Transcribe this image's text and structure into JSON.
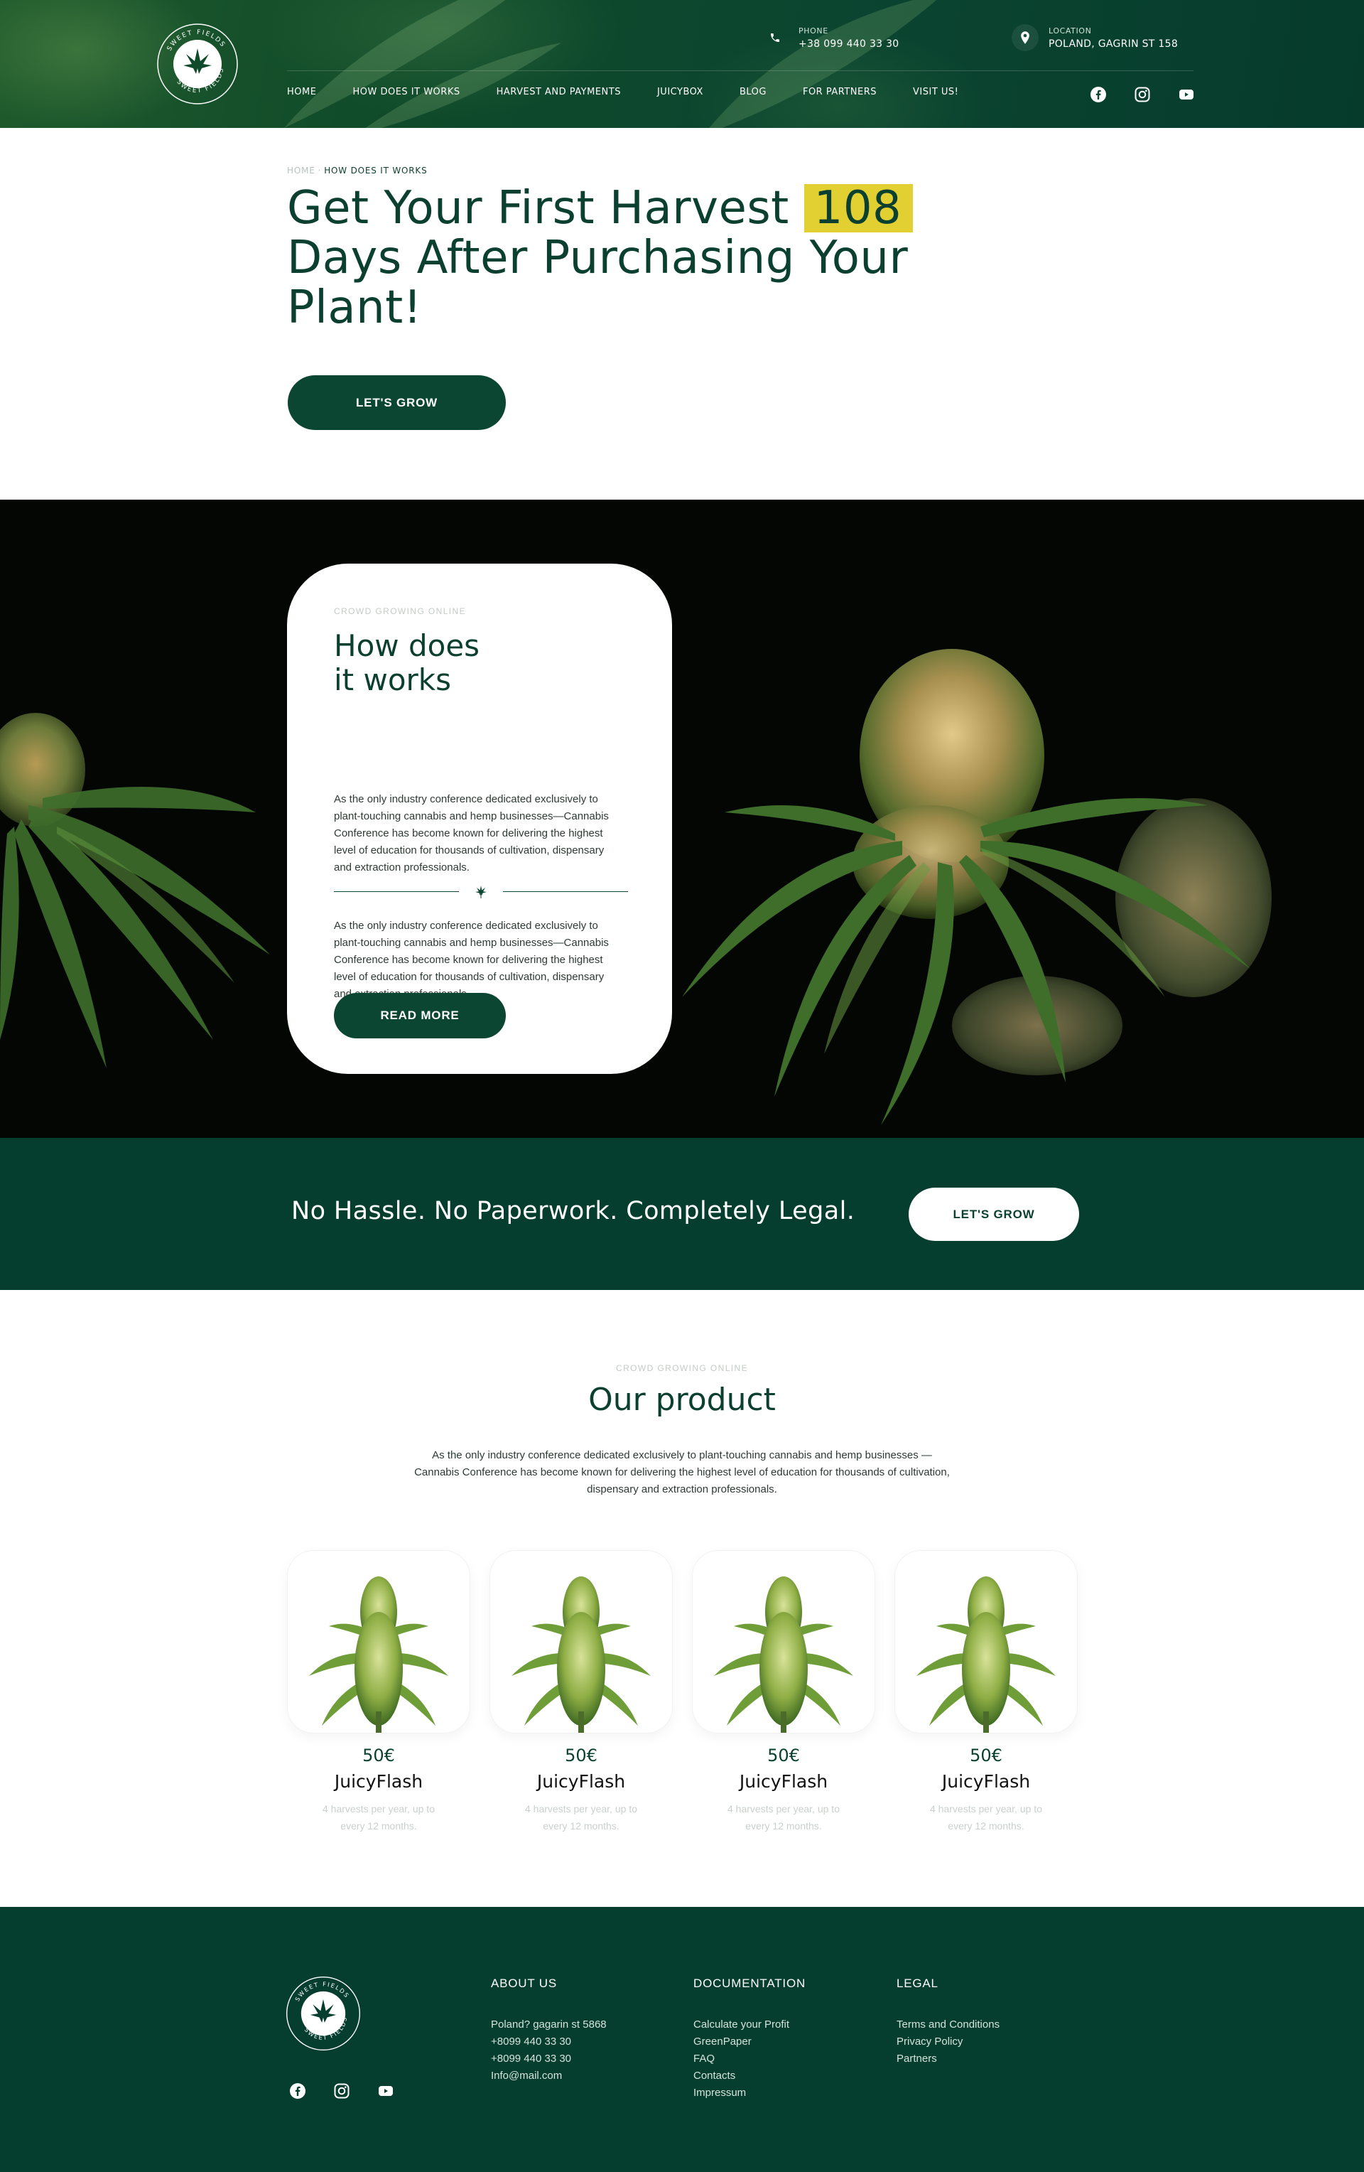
{
  "header": {
    "logo_text": "SWEET FIELDS",
    "phone": {
      "label": "PHONE",
      "value": "+38 099 440 33 30"
    },
    "location": {
      "label": "LOCATION",
      "value": "POLAND, GAGRIN ST 158"
    },
    "nav": [
      "HOME",
      "HOW DOES IT WORKS",
      "HARVEST AND PAYMENTS",
      "JUICYBOX",
      "BLOG",
      "FOR PARTNERS",
      "VISIT US!"
    ],
    "social_icons": [
      "facebook-icon",
      "instagram-icon",
      "youtube-icon"
    ]
  },
  "hero": {
    "breadcrumb": {
      "home": "HOME",
      "separator": "·",
      "current": "HOW DOES IT WORKS"
    },
    "title_line1": "Get Your First Harvest",
    "title_highlight": "108",
    "title_line2": "Days After Purchasing Your",
    "title_line3": "Plant!",
    "button": "LET'S GROW"
  },
  "how_it_works": {
    "eyebrow": "CROWD GROWING ONLINE",
    "title_line1": "How does",
    "title_line2": "it works",
    "paragraph1": "As the only industry conference dedicated exclusively to plant-touching cannabis and hemp businesses—Cannabis Conference has become known for delivering the highest level of education for thousands of cultivation, dispensary and extraction professionals.",
    "paragraph2": "As the only industry conference dedicated exclusively to plant-touching cannabis and hemp businesses—Cannabis Conference has become known for delivering the highest level of education for thousands of cultivation, dispensary and extraction professionals.",
    "button": "READ MORE"
  },
  "banner": {
    "text": "No Hassle. No Paperwork. Completely Legal.",
    "button": "LET'S GROW"
  },
  "products": {
    "eyebrow": "CROWD GROWING ONLINE",
    "title": "Our product",
    "description": "As the only industry conference dedicated exclusively to plant-touching cannabis and hemp businesses —Cannabis Conference has become known for delivering the highest level of education for thousands of cultivation, dispensary and extraction professionals.",
    "items": [
      {
        "price": "50€",
        "name": "JuicyFlash",
        "subtitle": "4 harvests per year, up to every 12 months."
      },
      {
        "price": "50€",
        "name": "JuicyFlash",
        "subtitle": "4 harvests per year, up to every 12 months."
      },
      {
        "price": "50€",
        "name": "JuicyFlash",
        "subtitle": "4 harvests per year, up to every 12 months."
      },
      {
        "price": "50€",
        "name": "JuicyFlash",
        "subtitle": "4 harvests per year, up to every 12 months."
      }
    ]
  },
  "footer": {
    "about": {
      "heading": "ABOUT US",
      "items": [
        "Poland? gagarin st 5868",
        "+8099 440 33 30",
        "+8099 440 33 30",
        "Info@mail.com"
      ]
    },
    "documentation": {
      "heading": "DOCUMENTATION",
      "items": [
        "Calculate your Profit",
        "GreenPaper",
        "FAQ",
        "Contacts",
        "Impressum"
      ]
    },
    "legal": {
      "heading": "LEGAL",
      "items": [
        "Terms and Conditions",
        "Privacy Policy",
        "Partners"
      ]
    }
  },
  "colors": {
    "primary": "#0b4632",
    "banner": "#053d2e",
    "highlight": "#e2d033",
    "text": "#0b3f2f"
  }
}
